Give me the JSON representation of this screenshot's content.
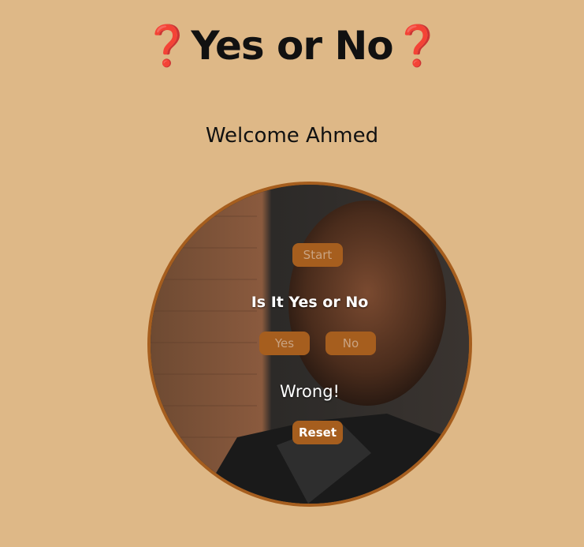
{
  "header": {
    "title": "Yes or No",
    "question_mark": "❓"
  },
  "welcome": {
    "text": "Welcome Ahmed"
  },
  "game": {
    "start_label": "Start",
    "question_text": "Is It Yes or No",
    "yes_label": "Yes",
    "no_label": "No",
    "result_text": "Wrong!",
    "reset_label": "Reset"
  },
  "colors": {
    "background": "#deb887",
    "accent": "#a65e1e",
    "question_mark": "#c8102e"
  }
}
